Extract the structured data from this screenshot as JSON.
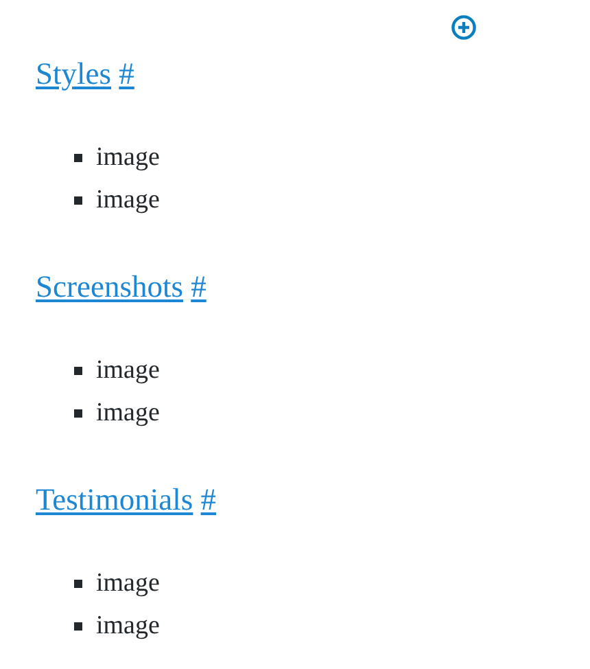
{
  "sections": [
    {
      "title": "Styles",
      "anchor": "#",
      "items": [
        "image",
        "image"
      ]
    },
    {
      "title": "Screenshots",
      "anchor": "#",
      "items": [
        "image",
        "image"
      ]
    },
    {
      "title": "Testimonials",
      "anchor": "#",
      "items": [
        "image",
        "image"
      ]
    }
  ]
}
